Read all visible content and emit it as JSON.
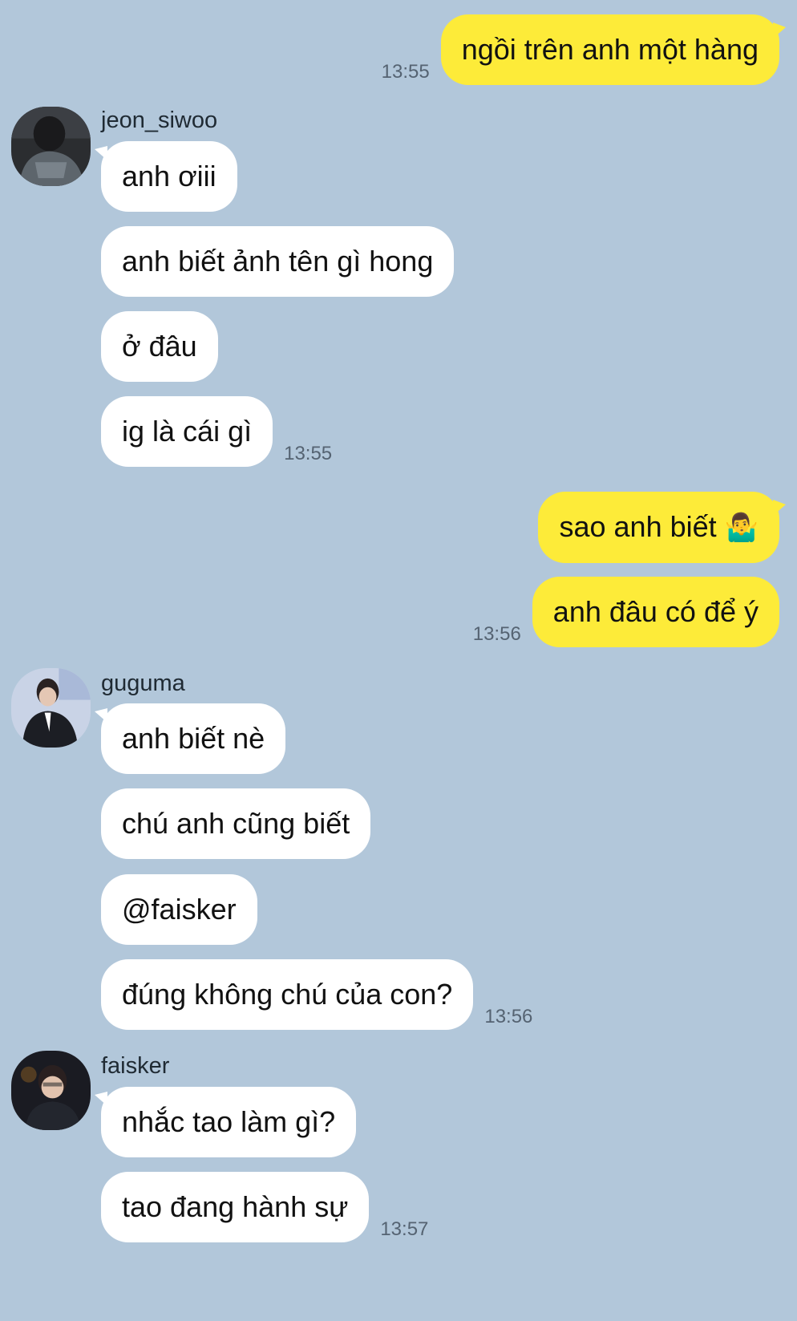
{
  "messages": [
    {
      "dir": "out",
      "text": "ngồi trên anh một hàng",
      "time": "13:55"
    },
    {
      "dir": "in",
      "text": "anh ơiii"
    },
    {
      "dir": "in",
      "text": "anh biết ảnh tên gì hong"
    },
    {
      "dir": "in",
      "text": "ở đâu"
    },
    {
      "dir": "in",
      "text": "ig là cái gì",
      "time": "13:55"
    },
    {
      "dir": "out",
      "text": "sao anh biết",
      "emoji": "🤷‍♂️"
    },
    {
      "dir": "out",
      "text": "anh đâu có để ý",
      "time": "13:56"
    },
    {
      "dir": "in",
      "text": "anh biết nè"
    },
    {
      "dir": "in",
      "text": "chú anh cũng biết"
    },
    {
      "dir": "in",
      "text": "@faisker"
    },
    {
      "dir": "in",
      "text": "đúng không chú của con?",
      "time": "13:56"
    },
    {
      "dir": "in",
      "text": "nhắc tao làm gì?"
    },
    {
      "dir": "in",
      "text": "tao đang hành sự",
      "time": "13:57"
    }
  ],
  "senders": [
    {
      "name": "jeon_siwoo",
      "avatar_icon": "avatar-jeon-siwoo"
    },
    {
      "name": "guguma",
      "avatar_icon": "avatar-guguma"
    },
    {
      "name": "faisker",
      "avatar_icon": "avatar-faisker"
    }
  ],
  "colors": {
    "background": "#b2c7da",
    "outgoing_bubble": "#fdeb39",
    "incoming_bubble": "#ffffff",
    "timestamp": "#556372"
  }
}
